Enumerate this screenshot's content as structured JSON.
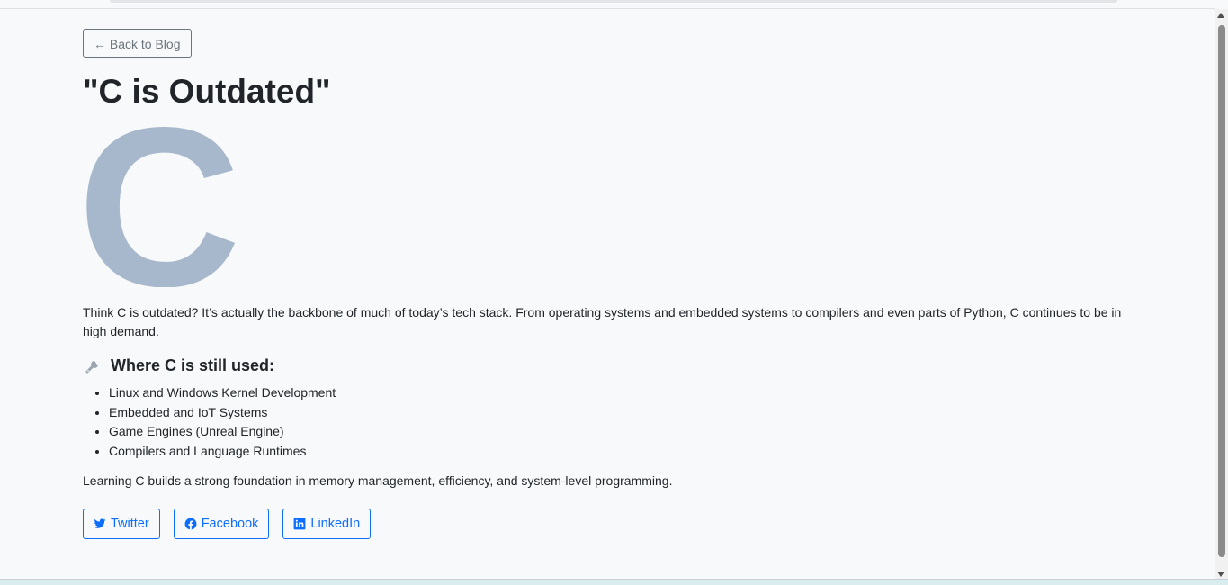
{
  "nav": {
    "back_label": "← Back to Blog"
  },
  "post": {
    "title": "\"C is Outdated\"",
    "hero_letter": "C",
    "intro": "Think C is outdated? It’s actually the backbone of much of today’s tech stack. From operating systems and embedded systems to compilers and even parts of Python, C continues to be in high demand.",
    "section_heading": "Where C is still used:",
    "section_icon": "wrench-icon",
    "uses": [
      "Linux and Windows Kernel Development",
      "Embedded and IoT Systems",
      "Game Engines (Unreal Engine)",
      "Compilers and Language Runtimes"
    ],
    "outro": "Learning C builds a strong foundation in memory management, efficiency, and system-level programming."
  },
  "share": {
    "twitter_label": "Twitter",
    "facebook_label": "Facebook",
    "linkedin_label": "LinkedIn"
  },
  "colors": {
    "accent": "#0d6efd",
    "hero_letter": "#a8b8cc",
    "secondary": "#6c757d"
  }
}
